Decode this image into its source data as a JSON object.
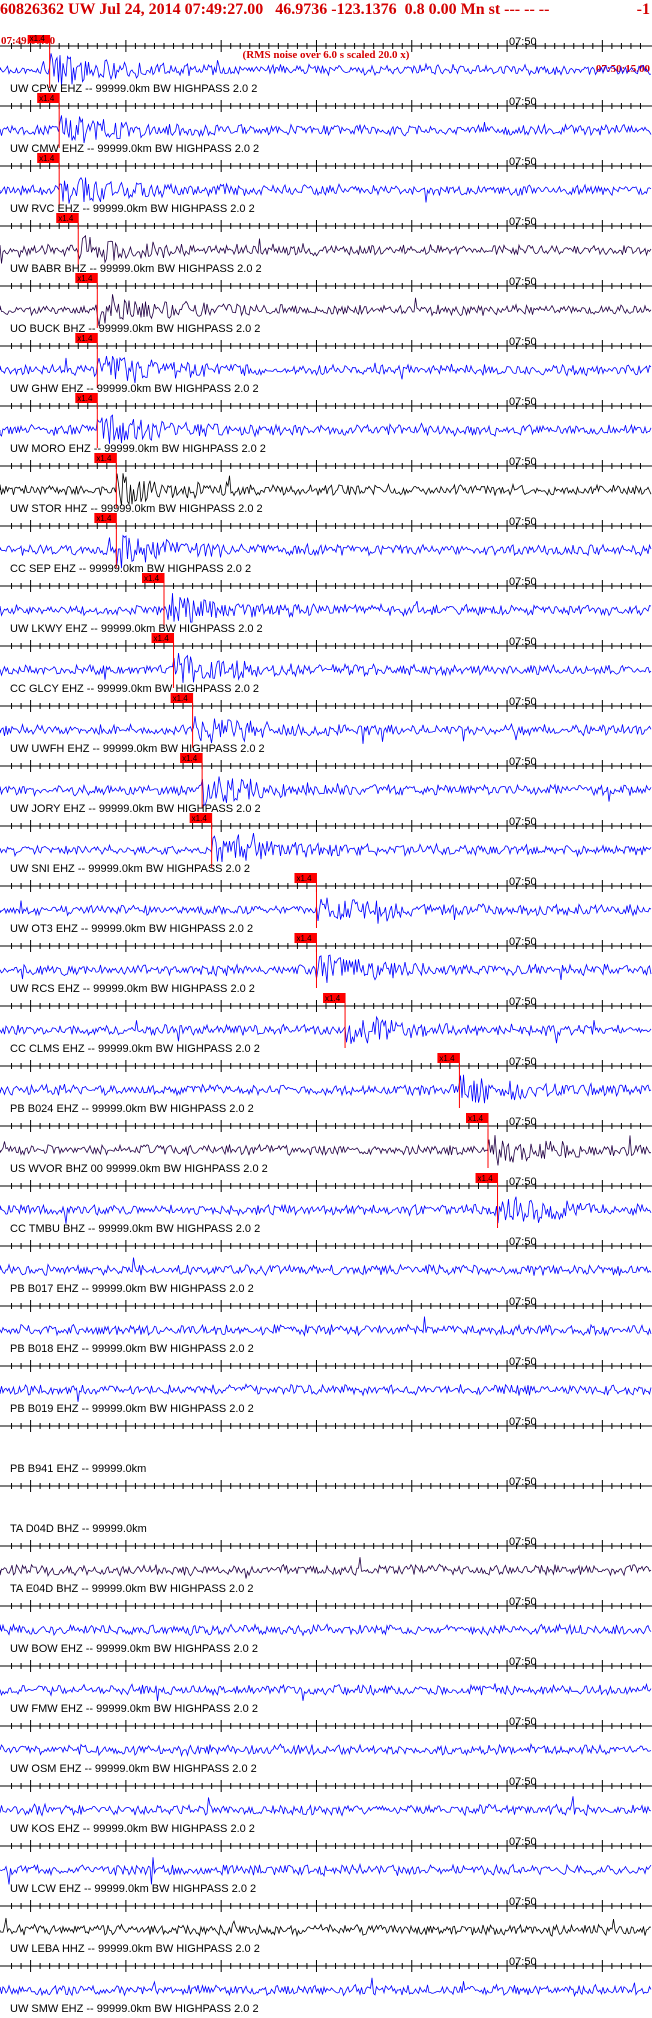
{
  "header": {
    "event_line": "60826362 UW Jul 24, 2014 07:49:27.00   46.9736 -123.1376  0.8 0.00 Mn st --- -- --",
    "event_flag": "-1",
    "start_time": "07:49:07.00",
    "scale_note": "(RMS noise over 6.0 s scaled 20.0 x)",
    "end_time": "07:50:15.00"
  },
  "time_mark": "07:50",
  "pick_label": "x1.4",
  "colors": {
    "header": "#d40000",
    "trace_blue": "#0000ff",
    "trace_dark": "#220044",
    "trace_black": "#000000",
    "pick": "#ff0000"
  },
  "traces": [
    {
      "label": "UW CPW EHZ -- 99999.0km BW  HIGHPASS  2.0  2",
      "pick_time": "07:49:12",
      "color": "blue"
    },
    {
      "label": "UW CMW EHZ -- 99999.0km BW  HIGHPASS  2.0  2",
      "pick_time": "07:49:13",
      "color": "blue"
    },
    {
      "label": "UW RVC EHZ -- 99999.0km BW  HIGHPASS  2.0  2",
      "pick_time": "07:49:13",
      "color": "blue"
    },
    {
      "label": "UW BABR BHZ -- 99999.0km BW  HIGHPASS  2.0  2",
      "pick_time": "07:49:15",
      "color": "dark"
    },
    {
      "label": "UO BUCK BHZ -- 99999.0km BW  HIGHPASS  2.0  2",
      "pick_time": "07:49:17",
      "color": "dark"
    },
    {
      "label": "UW GHW EHZ -- 99999.0km BW  HIGHPASS  2.0  2",
      "pick_time": "07:49:17",
      "color": "blue"
    },
    {
      "label": "UW MORO EHZ -- 99999.0km BW  HIGHPASS  2.0  2",
      "pick_time": "07:49:17",
      "color": "blue"
    },
    {
      "label": "UW STOR HHZ -- 99999.0km BW  HIGHPASS  2.0  2",
      "pick_time": "07:49:19",
      "color": "black"
    },
    {
      "label": "CC SEP EHZ -- 99999.0km BW  HIGHPASS  2.0  2",
      "pick_time": "07:49:19",
      "color": "blue"
    },
    {
      "label": "UW LKWY EHZ -- 99999.0km BW  HIGHPASS  2.0  2",
      "pick_time": "07:49:24",
      "color": "blue"
    },
    {
      "label": "CC GLCY EHZ -- 99999.0km BW  HIGHPASS  2.0  2",
      "pick_time": "07:49:25",
      "color": "blue"
    },
    {
      "label": "UW UWFH EHZ -- 99999.0km BW  HIGHPASS  2.0  2",
      "pick_time": "07:49:27",
      "color": "blue"
    },
    {
      "label": "UW JORY EHZ -- 99999.0km BW  HIGHPASS  2.0  2",
      "pick_time": "07:49:28",
      "color": "blue"
    },
    {
      "label": "UW SNI EHZ -- 99999.0km BW  HIGHPASS  2.0  2",
      "pick_time": "07:49:29",
      "color": "blue"
    },
    {
      "label": "UW OT3 EHZ -- 99999.0km BW  HIGHPASS  2.0  2",
      "pick_time": "07:49:40",
      "color": "blue"
    },
    {
      "label": "UW RCS EHZ -- 99999.0km BW  HIGHPASS  2.0  2",
      "pick_time": "07:49:40",
      "color": "blue"
    },
    {
      "label": "CC CLMS EHZ -- 99999.0km BW  HIGHPASS  2.0  2",
      "pick_time": "07:49:43",
      "color": "blue"
    },
    {
      "label": "PB B024 EHZ -- 99999.0km BW  HIGHPASS  2.0  2",
      "pick_time": "07:49:55",
      "color": "blue"
    },
    {
      "label": "US WVOR BHZ 00 99999.0km BW  HIGHPASS  2.0  2",
      "pick_time": "07:49:58",
      "color": "dark"
    },
    {
      "label": "CC TMBU BHZ -- 99999.0km BW  HIGHPASS  2.0  2",
      "pick_time": "07:49:59",
      "color": "blue"
    },
    {
      "label": "PB B017 EHZ -- 99999.0km BW  HIGHPASS  2.0  2",
      "pick_time": "",
      "color": "blue"
    },
    {
      "label": "PB B018 EHZ -- 99999.0km BW  HIGHPASS  2.0  2",
      "pick_time": "",
      "color": "blue"
    },
    {
      "label": "PB B019 EHZ -- 99999.0km BW  HIGHPASS  2.0  2",
      "pick_time": "",
      "color": "blue"
    },
    {
      "label": "PB B941 EHZ -- 99999.0km",
      "pick_time": "",
      "color": "none"
    },
    {
      "label": "TA D04D BHZ -- 99999.0km",
      "pick_time": "",
      "color": "none"
    },
    {
      "label": "TA E04D BHZ -- 99999.0km BW  HIGHPASS  2.0  2",
      "pick_time": "",
      "color": "dark"
    },
    {
      "label": "UW BOW EHZ -- 99999.0km BW  HIGHPASS  2.0  2",
      "pick_time": "",
      "color": "blue"
    },
    {
      "label": "UW FMW EHZ -- 99999.0km BW  HIGHPASS  2.0  2",
      "pick_time": "",
      "color": "blue"
    },
    {
      "label": "UW OSM EHZ -- 99999.0km BW  HIGHPASS  2.0  2",
      "pick_time": "",
      "color": "blue"
    },
    {
      "label": "UW KOS EHZ -- 99999.0km BW  HIGHPASS  2.0  2",
      "pick_time": "",
      "color": "blue"
    },
    {
      "label": "UW LCW EHZ -- 99999.0km BW  HIGHPASS  2.0  2",
      "pick_time": "",
      "color": "blue"
    },
    {
      "label": "UW LEBA HHZ -- 99999.0km BW  HIGHPASS  2.0  2",
      "pick_time": "",
      "color": "black"
    },
    {
      "label": "UW SMW EHZ -- 99999.0km BW  HIGHPASS  2.0  2",
      "pick_time": "",
      "color": "blue"
    }
  ]
}
